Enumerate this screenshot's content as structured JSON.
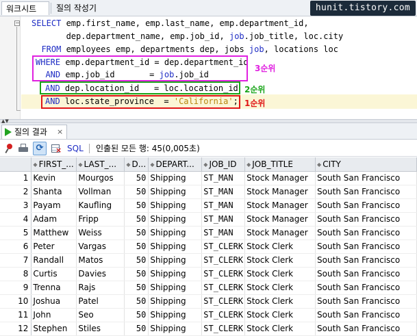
{
  "tabs": {
    "worksheet": "워크시트",
    "query_builder": "질의 작성기"
  },
  "watermark": "hunit.tistory.com",
  "editor": {
    "lines": [
      {
        "kw1": "SELECT ",
        "t1": "emp.first_name, emp.last_name, emp.department_id,"
      },
      {
        "t1": "       dep.department_name, emp.job_id, ",
        "kw1": "job",
        "t2": ".job_title, loc.city"
      },
      {
        "kw1": "  FROM ",
        "t1": "employees emp, departments dep, jobs ",
        "kw2": "job",
        "t2": ", locations loc"
      },
      {
        "kw1": "WHERE ",
        "t1": "emp.department_id = dep.department_id"
      },
      {
        "kw1": "  AND ",
        "t1": "emp.job_id       = ",
        "kw2": "job",
        "t2": ".job_id"
      },
      {
        "kw1": "AND ",
        "t1": "dep.location_id   = loc.location_id"
      },
      {
        "kw1": "AND ",
        "t1": "loc.state_province  = ",
        "str": "'California'",
        "t2": ";"
      }
    ],
    "annotations": {
      "third": "3순위",
      "second": "2순위",
      "first": "1순위"
    }
  },
  "results": {
    "tab_label": "질의 결과",
    "close": "×",
    "sql_label": "SQL",
    "status": "인출된 모든 행: 45(0,005초)"
  },
  "table": {
    "columns": [
      "FIRST_...",
      "LAST_...",
      "D...",
      "DEPART...",
      "JOB_ID",
      "JOB_TITLE",
      "CITY"
    ],
    "rows": [
      [
        "1",
        "Kevin",
        "Mourgos",
        "50",
        "Shipping",
        "ST_MAN",
        "Stock Manager",
        "South San Francisco"
      ],
      [
        "2",
        "Shanta",
        "Vollman",
        "50",
        "Shipping",
        "ST_MAN",
        "Stock Manager",
        "South San Francisco"
      ],
      [
        "3",
        "Payam",
        "Kaufling",
        "50",
        "Shipping",
        "ST_MAN",
        "Stock Manager",
        "South San Francisco"
      ],
      [
        "4",
        "Adam",
        "Fripp",
        "50",
        "Shipping",
        "ST_MAN",
        "Stock Manager",
        "South San Francisco"
      ],
      [
        "5",
        "Matthew",
        "Weiss",
        "50",
        "Shipping",
        "ST_MAN",
        "Stock Manager",
        "South San Francisco"
      ],
      [
        "6",
        "Peter",
        "Vargas",
        "50",
        "Shipping",
        "ST_CLERK",
        "Stock Clerk",
        "South San Francisco"
      ],
      [
        "7",
        "Randall",
        "Matos",
        "50",
        "Shipping",
        "ST_CLERK",
        "Stock Clerk",
        "South San Francisco"
      ],
      [
        "8",
        "Curtis",
        "Davies",
        "50",
        "Shipping",
        "ST_CLERK",
        "Stock Clerk",
        "South San Francisco"
      ],
      [
        "9",
        "Trenna",
        "Rajs",
        "50",
        "Shipping",
        "ST_CLERK",
        "Stock Clerk",
        "South San Francisco"
      ],
      [
        "10",
        "Joshua",
        "Patel",
        "50",
        "Shipping",
        "ST_CLERK",
        "Stock Clerk",
        "South San Francisco"
      ],
      [
        "11",
        "John",
        "Seo",
        "50",
        "Shipping",
        "ST_CLERK",
        "Stock Clerk",
        "South San Francisco"
      ],
      [
        "12",
        "Stephen",
        "Stiles",
        "50",
        "Shipping",
        "ST_CLERK",
        "Stock Clerk",
        "South San Francisco"
      ]
    ]
  },
  "colors": {
    "keyword": "#1e2cc4",
    "priority3": "#e020e0",
    "priority2": "#1aa51a",
    "priority1": "#e01515",
    "current_line": "#fbf6d6"
  }
}
